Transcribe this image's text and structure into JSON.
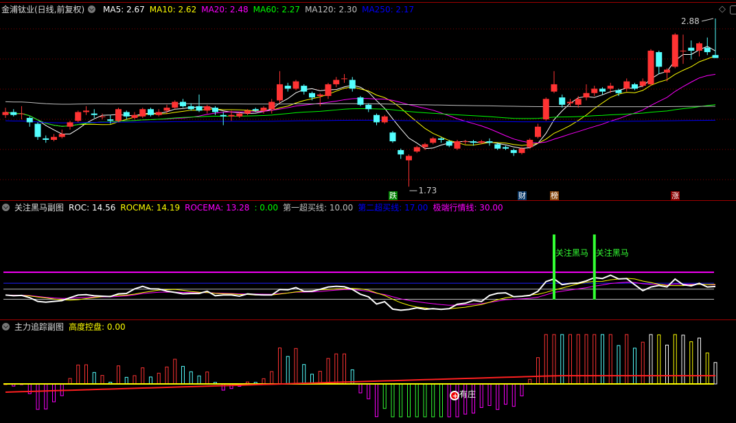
{
  "main": {
    "title": "金浦钛业(日线,前复权)",
    "ma": [
      {
        "label": "MA5: 2.67",
        "color": "#ffffff"
      },
      {
        "label": "MA10: 2.62",
        "color": "#ffff00"
      },
      {
        "label": "MA20: 2.48",
        "color": "#ff00ff"
      },
      {
        "label": "MA60: 2.27",
        "color": "#00ff00"
      },
      {
        "label": "MA120: 2.30",
        "color": "#c0c0c0"
      },
      {
        "label": "MA250: 2.17",
        "color": "#0000ff"
      }
    ],
    "high_label": "2.88",
    "low_label": "1.73",
    "markers": [
      {
        "text": "跌",
        "color": "#008000",
        "index": 48
      },
      {
        "text": "财",
        "color": "#0a3a6a",
        "index": 64
      },
      {
        "text": "榜",
        "color": "#8a4a10",
        "index": 68
      },
      {
        "text": "涨",
        "color": "#8a0000",
        "index": 83
      }
    ]
  },
  "sub1": {
    "title": "关注黑马副图",
    "items": [
      {
        "label": "ROC: 14.56",
        "color": "#ffffff"
      },
      {
        "label": "ROCMA: 14.19",
        "color": "#ffff00"
      },
      {
        "label": "ROCEMA: 13.28",
        "color": "#ff00ff"
      },
      {
        "label": ": 0.00",
        "color": "#00ff00"
      },
      {
        "label": "第一超买线: 10.00",
        "color": "#c0c0c0"
      },
      {
        "label": "第二超买线: 17.00",
        "color": "#0000ff"
      },
      {
        "label": "极端行情线: 30.00",
        "color": "#ff00ff"
      }
    ],
    "levels": [
      {
        "value": 30,
        "color": "#ff00ff"
      },
      {
        "value": 17,
        "color": "#2020ff"
      },
      {
        "value": 10,
        "color": "#c0c0c0"
      },
      {
        "value": -2,
        "color": "#c0c0c0"
      }
    ],
    "signals": [
      {
        "index": 68,
        "text": "关注黑马"
      },
      {
        "index": 73,
        "text": "关注黑马"
      }
    ]
  },
  "sub2": {
    "title": "主力追踪副图",
    "items": [
      {
        "label": "高度控盘: 0.00",
        "color": "#ffff00"
      }
    ],
    "badge_text": "有庄",
    "badge_index": 56
  },
  "chart_data": {
    "type": "candlestick",
    "title": "金浦钛业(日线,前复权)",
    "ylim": [
      1.73,
      2.88
    ],
    "fields": [
      "open",
      "close",
      "high",
      "low"
    ],
    "candles": [
      [
        2.22,
        2.24,
        2.27,
        2.2
      ],
      [
        2.24,
        2.22,
        2.26,
        2.21
      ],
      [
        2.23,
        2.23,
        2.28,
        2.19
      ],
      [
        2.2,
        2.17,
        2.21,
        2.14
      ],
      [
        2.16,
        2.07,
        2.17,
        2.05
      ],
      [
        2.06,
        2.05,
        2.08,
        2.03
      ],
      [
        2.05,
        2.07,
        2.09,
        2.04
      ],
      [
        2.07,
        2.09,
        2.12,
        2.06
      ],
      [
        2.14,
        2.17,
        2.18,
        2.12
      ],
      [
        2.18,
        2.24,
        2.25,
        2.17
      ],
      [
        2.24,
        2.25,
        2.28,
        2.22
      ],
      [
        2.23,
        2.22,
        2.26,
        2.2
      ],
      [
        2.21,
        2.21,
        2.23,
        2.19
      ],
      [
        2.19,
        2.18,
        2.22,
        2.16
      ],
      [
        2.18,
        2.26,
        2.27,
        2.17
      ],
      [
        2.24,
        2.21,
        2.25,
        2.19
      ],
      [
        2.2,
        2.22,
        2.24,
        2.19
      ],
      [
        2.21,
        2.26,
        2.27,
        2.2
      ],
      [
        2.26,
        2.22,
        2.27,
        2.21
      ],
      [
        2.22,
        2.24,
        2.26,
        2.21
      ],
      [
        2.25,
        2.27,
        2.29,
        2.23
      ],
      [
        2.27,
        2.31,
        2.32,
        2.26
      ],
      [
        2.31,
        2.28,
        2.33,
        2.27
      ],
      [
        2.28,
        2.26,
        2.3,
        2.25
      ],
      [
        2.28,
        2.25,
        2.36,
        2.24
      ],
      [
        2.25,
        2.28,
        2.29,
        2.23
      ],
      [
        2.27,
        2.24,
        2.28,
        2.22
      ],
      [
        2.22,
        2.21,
        2.24,
        2.15
      ],
      [
        2.21,
        2.22,
        2.25,
        2.18
      ],
      [
        2.21,
        2.23,
        2.24,
        2.2
      ],
      [
        2.23,
        2.25,
        2.26,
        2.22
      ],
      [
        2.26,
        2.25,
        2.27,
        2.24
      ],
      [
        2.25,
        2.27,
        2.28,
        2.23
      ],
      [
        2.26,
        2.31,
        2.33,
        2.23
      ],
      [
        2.32,
        2.43,
        2.52,
        2.3
      ],
      [
        2.42,
        2.4,
        2.44,
        2.38
      ],
      [
        2.4,
        2.45,
        2.46,
        2.39
      ],
      [
        2.42,
        2.38,
        2.43,
        2.36
      ],
      [
        2.37,
        2.34,
        2.38,
        2.32
      ],
      [
        2.35,
        2.36,
        2.37,
        2.28
      ],
      [
        2.35,
        2.43,
        2.44,
        2.33
      ],
      [
        2.43,
        2.46,
        2.48,
        2.41
      ],
      [
        2.47,
        2.47,
        2.5,
        2.44
      ],
      [
        2.46,
        2.4,
        2.48,
        2.38
      ],
      [
        2.34,
        2.29,
        2.35,
        2.28
      ],
      [
        2.29,
        2.26,
        2.3,
        2.24
      ],
      [
        2.22,
        2.17,
        2.23,
        2.15
      ],
      [
        2.17,
        2.21,
        2.22,
        2.16
      ],
      [
        2.1,
        2.04,
        2.11,
        2.03
      ],
      [
        1.98,
        1.95,
        1.99,
        1.92
      ],
      [
        1.91,
        1.94,
        1.95,
        1.73
      ],
      [
        1.97,
        2.0,
        2.01,
        1.96
      ],
      [
        2.0,
        2.02,
        2.03,
        1.98
      ],
      [
        2.03,
        2.06,
        2.07,
        2.02
      ],
      [
        2.06,
        2.05,
        2.07,
        2.03
      ],
      [
        2.04,
        2.01,
        2.05,
        2.0
      ],
      [
        1.99,
        2.04,
        2.05,
        1.98
      ],
      [
        2.04,
        2.04,
        2.05,
        2.02
      ],
      [
        2.04,
        2.03,
        2.05,
        2.01
      ],
      [
        2.03,
        2.04,
        2.05,
        2.02
      ],
      [
        2.04,
        2.03,
        2.06,
        2.01
      ],
      [
        2.02,
        1.99,
        2.03,
        1.98
      ],
      [
        2.0,
        1.99,
        2.01,
        1.98
      ],
      [
        1.98,
        1.96,
        1.99,
        1.94
      ],
      [
        1.96,
        1.99,
        2.0,
        1.95
      ],
      [
        2.0,
        2.05,
        2.06,
        1.99
      ],
      [
        2.07,
        2.14,
        2.16,
        2.06
      ],
      [
        2.19,
        2.33,
        2.34,
        2.18
      ],
      [
        2.38,
        2.43,
        2.52,
        2.37
      ],
      [
        2.34,
        2.29,
        2.36,
        2.27
      ],
      [
        2.3,
        2.31,
        2.33,
        2.28
      ],
      [
        2.29,
        2.33,
        2.35,
        2.27
      ],
      [
        2.34,
        2.37,
        2.43,
        2.32
      ],
      [
        2.37,
        2.4,
        2.42,
        2.35
      ],
      [
        2.4,
        2.38,
        2.41,
        2.36
      ],
      [
        2.4,
        2.42,
        2.44,
        2.37
      ],
      [
        2.39,
        2.37,
        2.4,
        2.35
      ],
      [
        2.4,
        2.45,
        2.47,
        2.38
      ],
      [
        2.43,
        2.4,
        2.44,
        2.39
      ],
      [
        2.42,
        2.45,
        2.47,
        2.41
      ],
      [
        2.43,
        2.66,
        2.67,
        2.42
      ],
      [
        2.65,
        2.55,
        2.66,
        2.5
      ],
      [
        2.51,
        2.53,
        2.54,
        2.45
      ],
      [
        2.55,
        2.77,
        2.78,
        2.54
      ],
      [
        2.66,
        2.66,
        2.77,
        2.57
      ],
      [
        2.68,
        2.66,
        2.73,
        2.6
      ],
      [
        2.66,
        2.71,
        2.72,
        2.62
      ],
      [
        2.68,
        2.65,
        2.75,
        2.63
      ],
      [
        2.63,
        2.61,
        2.88,
        2.61
      ]
    ],
    "ma_periods": [
      5,
      10,
      20,
      60,
      120,
      250
    ],
    "colors": {
      "up": "#ff3333",
      "down": "#54ffff",
      "ma5": "#ffffff",
      "ma10": "#ffff00",
      "ma20": "#ff00ff",
      "ma60": "#00ff00",
      "ma120": "#c0c0c0",
      "ma250": "#0000ff"
    }
  }
}
